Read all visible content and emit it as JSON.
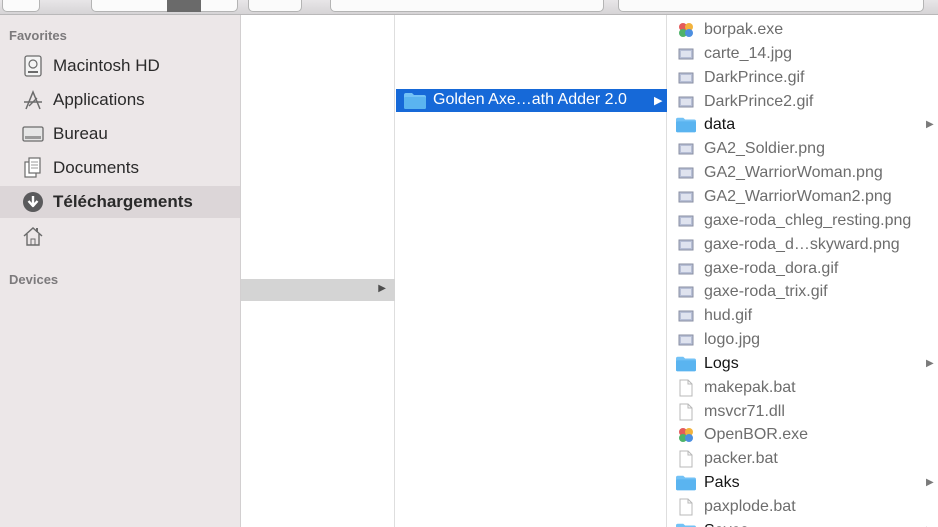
{
  "sidebar": {
    "favorites_heading": "Favorites",
    "devices_heading": "Devices",
    "items": [
      {
        "label": "Macintosh HD",
        "icon": "hard-drive-icon"
      },
      {
        "label": "Applications",
        "icon": "applications-icon"
      },
      {
        "label": "Bureau",
        "icon": "desktop-icon"
      },
      {
        "label": "Documents",
        "icon": "documents-icon"
      },
      {
        "label": "Téléchargements",
        "icon": "downloads-icon",
        "selected": true
      },
      {
        "label": "",
        "icon": "home-icon"
      }
    ]
  },
  "column2": {
    "selected_folder": "Golden Axe…ath Adder 2.0"
  },
  "column3": {
    "files": [
      {
        "name": "borpak.exe",
        "kind": "exe"
      },
      {
        "name": "carte_14.jpg",
        "kind": "image"
      },
      {
        "name": "DarkPrince.gif",
        "kind": "image"
      },
      {
        "name": "DarkPrince2.gif",
        "kind": "image"
      },
      {
        "name": "data",
        "kind": "folder"
      },
      {
        "name": "GA2_Soldier.png",
        "kind": "image"
      },
      {
        "name": "GA2_WarriorWoman.png",
        "kind": "image"
      },
      {
        "name": "GA2_WarriorWoman2.png",
        "kind": "image"
      },
      {
        "name": "gaxe-roda_chleg_resting.png",
        "kind": "image"
      },
      {
        "name": "gaxe-roda_d…skyward.png",
        "kind": "image"
      },
      {
        "name": "gaxe-roda_dora.gif",
        "kind": "image"
      },
      {
        "name": "gaxe-roda_trix.gif",
        "kind": "image"
      },
      {
        "name": "hud.gif",
        "kind": "image"
      },
      {
        "name": "logo.jpg",
        "kind": "image"
      },
      {
        "name": "Logs",
        "kind": "folder"
      },
      {
        "name": "makepak.bat",
        "kind": "document"
      },
      {
        "name": "msvcr71.dll",
        "kind": "document"
      },
      {
        "name": "OpenBOR.exe",
        "kind": "exe"
      },
      {
        "name": "packer.bat",
        "kind": "document"
      },
      {
        "name": "Paks",
        "kind": "folder"
      },
      {
        "name": "paxplode.bat",
        "kind": "document"
      },
      {
        "name": "Saves",
        "kind": "folder"
      }
    ]
  },
  "colors": {
    "selection_blue": "#1669d8",
    "folder_blue": "#5ab4f0",
    "sidebar_bg": "#ece7e8",
    "sidebar_selected": "#dcd6d8"
  }
}
